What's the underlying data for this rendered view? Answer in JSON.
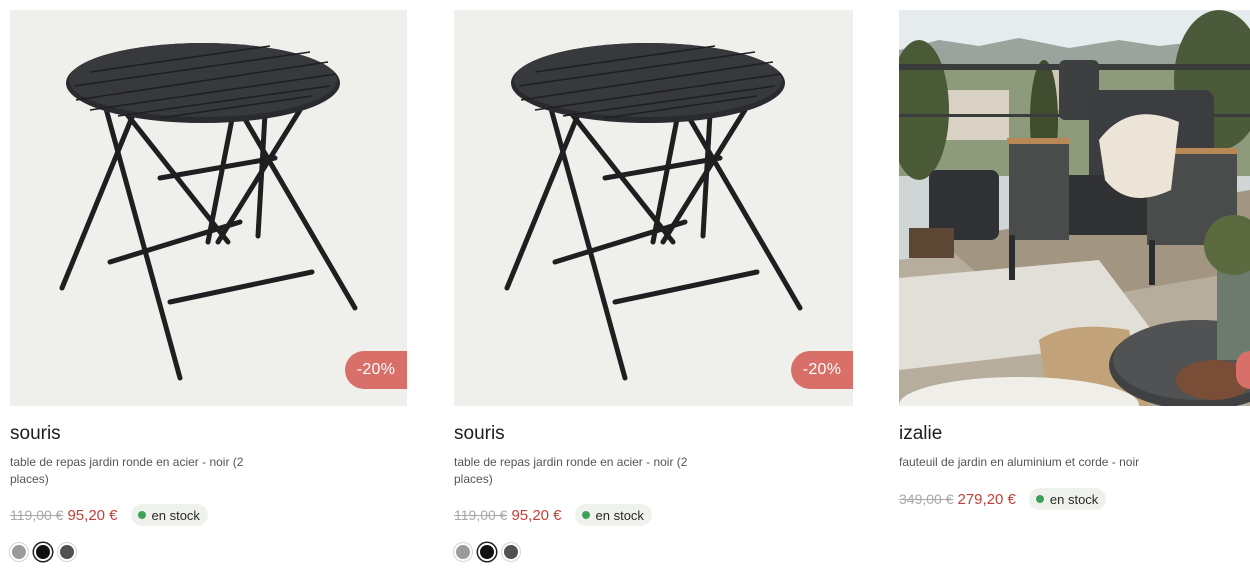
{
  "products": [
    {
      "name": "souris",
      "description": "table de repas jardin ronde en acier - noir (2 places)",
      "old_price": "119,00 €",
      "new_price": "95,20 €",
      "discount": "-20%",
      "stock": "en stock",
      "swatches": [
        {
          "color": "#9b9b9b",
          "selected": false
        },
        {
          "color": "#111111",
          "selected": true
        },
        {
          "color": "#505251",
          "selected": false
        }
      ]
    },
    {
      "name": "souris",
      "description": "table de repas jardin ronde en acier - noir (2 places)",
      "old_price": "119,00 €",
      "new_price": "95,20 €",
      "discount": "-20%",
      "stock": "en stock",
      "swatches": [
        {
          "color": "#9b9b9b",
          "selected": false
        },
        {
          "color": "#111111",
          "selected": true
        },
        {
          "color": "#505251",
          "selected": false
        }
      ]
    },
    {
      "name": "izalie",
      "description": "fauteuil de jardin en aluminium et corde - noir",
      "old_price": "349,00 €",
      "new_price": "279,20 €",
      "stock": "en stock"
    }
  ],
  "colors": {
    "discount_badge": "#d86f68",
    "sale_price": "#c2403a",
    "stock_dot": "#3ea35a",
    "image_background": "#efefeb"
  }
}
